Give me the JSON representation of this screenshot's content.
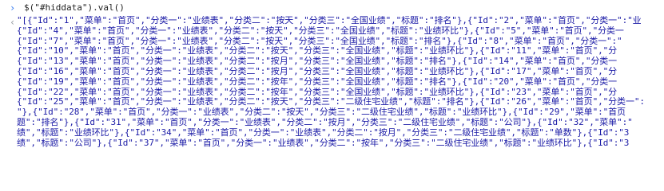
{
  "console": {
    "prompt_symbol": "›",
    "result_symbol": "‹",
    "command": "$(\"#hiddata\").val()",
    "output_lines": [
      "\"[{\"Id\":\"1\",\"菜单\":\"首页\",\"分类一\":\"业绩表\",\"分类二\":\"按天\",\"分类三\":\"全国业绩\",\"标题\":\"排名\"},{\"Id\":\"2\",\"菜单\":\"首页\",\"分类一\":\"业",
      "{\"Id\":\"4\",\"菜单\":\"首页\",\"分类一\":\"业绩表\",\"分类二\":\"按天\",\"分类三\":\"全国业绩\",\"标题\":\"业绩环比\"},{\"Id\":\"5\",\"菜单\":\"首页\",\"分类一",
      "{\"Id\":\"7\",\"菜单\":\"首页\",\"分类一\":\"业绩表\",\"分类二\":\"按天\",\"分类三\":\"全国业绩\",\"标题\":\"排名\"},{\"Id\":\"8\",\"菜单\":\"首页\",\"分类一\":\"",
      "{\"Id\":\"10\",\"菜单\":\"首页\",\"分类一\":\"业绩表\",\"分类二\":\"按天\",\"分类三\":\"全国业绩\",\"标题\":\"业绩环比\"},{\"Id\":\"11\",\"菜单\":\"首页\",\"分",
      "{\"Id\":\"13\",\"菜单\":\"首页\",\"分类一\":\"业绩表\",\"分类二\":\"按月\",\"分类三\":\"全国业绩\",\"标题\":\"排名\"},{\"Id\":\"14\",\"菜单\":\"首页\",\"分类一",
      "{\"Id\":\"16\",\"菜单\":\"首页\",\"分类一\":\"业绩表\",\"分类二\":\"按月\",\"分类三\":\"全国业绩\",\"标题\":\"业绩环比\"},{\"Id\":\"17\",\"菜单\":\"首页\",\"分",
      "{\"Id\":\"19\",\"菜单\":\"首页\",\"分类一\":\"业绩表\",\"分类二\":\"按年\",\"分类三\":\"全国业绩\",\"标题\":\"排名\"},{\"Id\":\"20\",\"菜单\":\"首页\",\"分类一",
      "{\"Id\":\"22\",\"菜单\":\"首页\",\"分类一\":\"业绩表\",\"分类二\":\"按年\",\"分类三\":\"全国业绩\",\"标题\":\"业绩环比\"},{\"Id\":\"23\",\"菜单\":\"首页\",\"分",
      "{\"Id\":\"25\",\"菜单\":\"首页\",\"分类一\":\"业绩表\",\"分类二\":\"按天\",\"分类三\":\"二级住宅业绩\",\"标题\":\"排名\"},{\"Id\":\"26\",\"菜单\":\"首页\",\"分类一\":",
      "\"},{\"Id\":\"28\",\"菜单\":\"首页\",\"分类一\":\"业绩表\",\"分类二\":\"按天\",\"分类三\":\"二级住宅业绩\",\"标题\":\"业绩环比\"},{\"Id\":\"29\",\"菜单\":\"首页",
      "题\":\"排名\"},{\"Id\":\"31\",\"菜单\":\"首页\",\"分类一\":\"业绩表\",\"分类二\":\"按月\",\"分类三\":\"二级住宅业绩\",\"标题\":\"公司\"},{\"Id\":\"32\",\"菜单\":\"",
      "绩\",\"标题\":\"业绩环比\"},{\"Id\":\"34\",\"菜单\":\"首页\",\"分类一\":\"业绩表\",\"分类二\":\"按月\",\"分类三\":\"二级住宅业绩\",\"标题\":\"单数\"},{\"Id\":\"3",
      "绩\",\"标题\":\"公司\"},{\"Id\":\"37\",\"菜单\":\"首页\",\"分类一\":\"业绩表\",\"分类二\":\"按年\",\"分类三\":\"二级住宅业绩\",\"标题\":\"业绩环比\"},{\"Id\":\"3"
    ]
  }
}
